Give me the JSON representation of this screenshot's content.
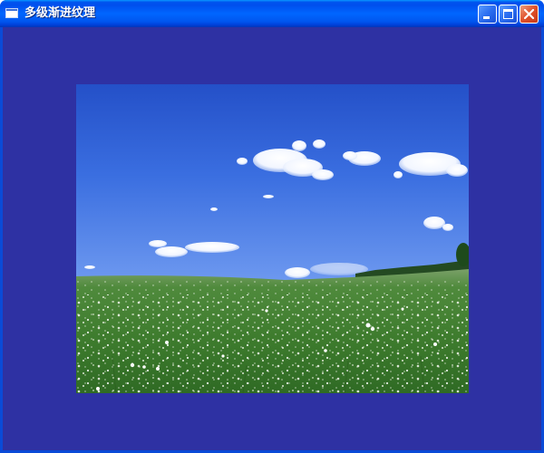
{
  "window": {
    "title": "多级渐进纹理",
    "icon": "window-icon",
    "controls": {
      "minimize": "minimize-icon",
      "maximize": "maximize-icon",
      "close": "close-icon"
    }
  },
  "colors": {
    "titlebar": "#0058ee",
    "client_background": "#2e31a3",
    "close_button": "#e0502a"
  },
  "content": {
    "image": "textured-photo",
    "scene": "sky-and-flower-meadow"
  }
}
